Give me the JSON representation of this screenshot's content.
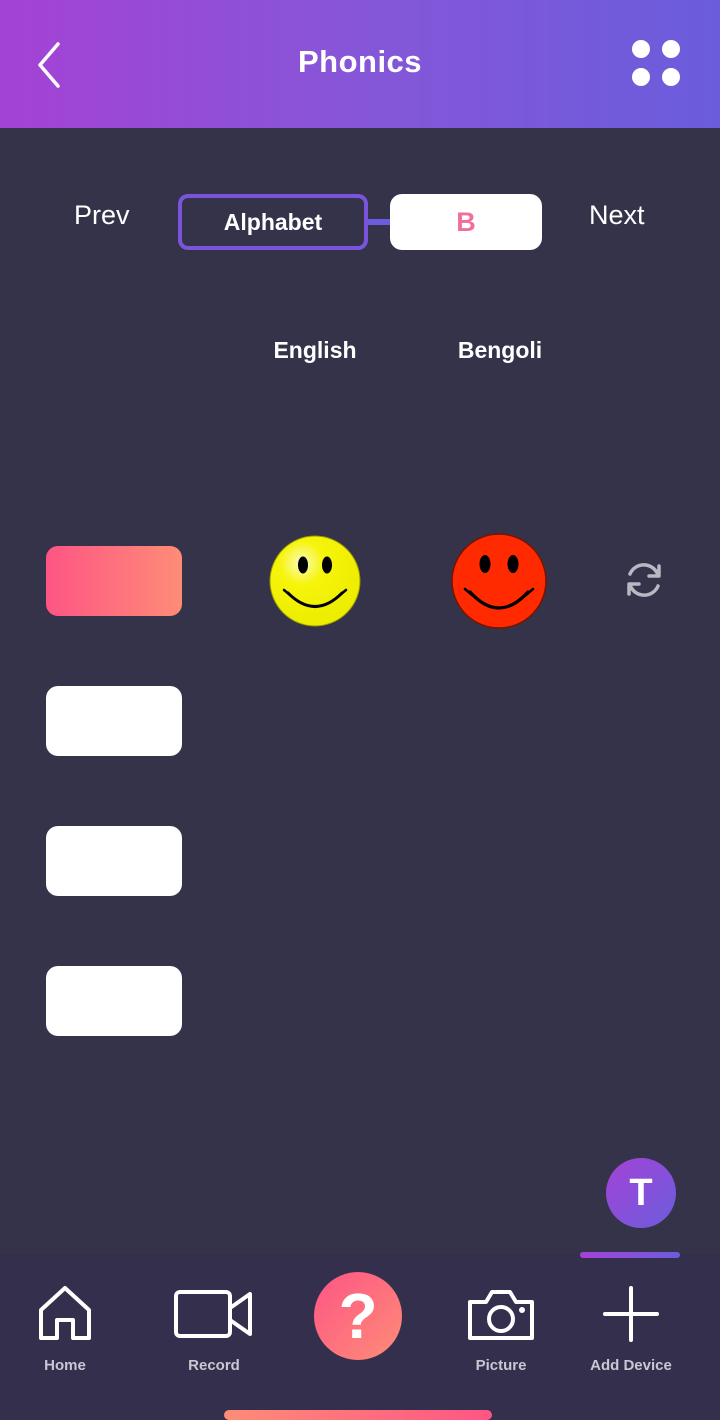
{
  "header": {
    "title": "Phonics",
    "back_icon": "chevron-left-icon",
    "menu_icon": "grid-dots-icon",
    "gradient": [
      "#a442d6",
      "#6a5ddc"
    ]
  },
  "navigator": {
    "prev_label": "Prev",
    "category_label": "Alphabet",
    "current_letter": "B",
    "next_label": "Next"
  },
  "columns": {
    "english_label": "English",
    "bengali_label": "Bengoli"
  },
  "options": [
    {
      "active": true
    },
    {
      "active": false
    },
    {
      "active": false
    },
    {
      "active": false
    }
  ],
  "results": {
    "english_icon": "yellow-smiley-icon",
    "bengali_icon": "red-smiley-icon",
    "refresh_icon": "refresh-icon"
  },
  "avatar": {
    "initial": "T"
  },
  "bottom_nav": {
    "home_label": "Home",
    "record_label": "Record",
    "help_label": "?",
    "picture_label": "Picture",
    "add_device_label": "Add Device"
  },
  "colors": {
    "background": "#35334a",
    "accent_pink": "#fe5584",
    "accent_orange": "#fe8c77",
    "accent_purple": "#7a55dc",
    "letter_color": "#f0709a"
  }
}
